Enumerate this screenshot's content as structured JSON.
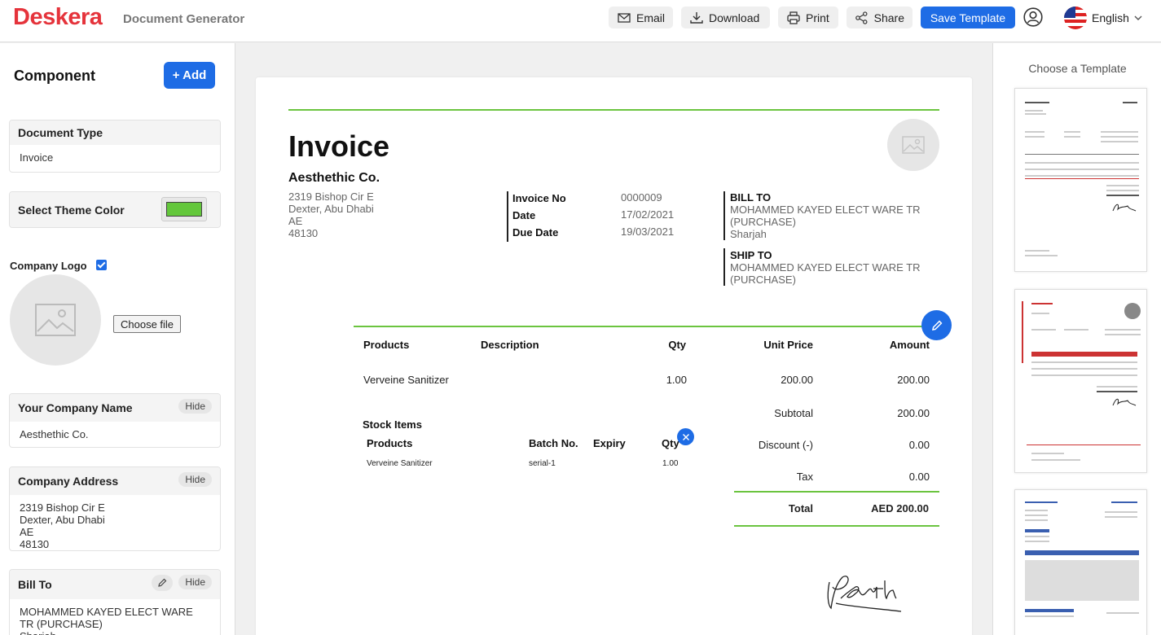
{
  "header": {
    "brand": "Deskera",
    "app_title": "Document Generator",
    "email_label": "Email",
    "download_label": "Download",
    "print_label": "Print",
    "share_label": "Share",
    "save_label": "Save Template",
    "language": "English"
  },
  "sidebar": {
    "title": "Component",
    "add_label": "+ Add",
    "document_type": {
      "label": "Document Type",
      "value": "Invoice"
    },
    "theme": {
      "label": "Select Theme Color",
      "color": "#63c73b"
    },
    "company_logo": {
      "label": "Company Logo",
      "checked": true,
      "choose_label": "Choose file"
    },
    "company_name": {
      "label": "Your Company Name",
      "value": "Aesthethic Co.",
      "hide_label": "Hide"
    },
    "company_address": {
      "label": "Company Address",
      "value": "2319 Bishop Cir E\nDexter, Abu Dhabi\nAE\n48130",
      "hide_label": "Hide"
    },
    "bill_to": {
      "label": "Bill To",
      "value": "MOHAMMED KAYED ELECT WARE\nTR (PURCHASE)\nSharjah",
      "hide_label": "Hide"
    }
  },
  "doc": {
    "title": "Invoice",
    "company_name": "Aesthethic Co.",
    "company_address": "2319 Bishop Cir E\nDexter, Abu Dhabi\nAE\n48130",
    "meta": {
      "invoice_no_label": "Invoice No",
      "invoice_no": "0000009",
      "date_label": "Date",
      "date": "17/02/2021",
      "due_label": "Due Date",
      "due": "19/03/2021"
    },
    "bill_to_label": "BILL TO",
    "bill_to": "MOHAMMED KAYED ELECT WARE TR\n(PURCHASE)\nSharjah",
    "ship_to_label": "SHIP TO",
    "ship_to": "MOHAMMED KAYED ELECT WARE TR\n(PURCHASE)",
    "table": {
      "headers": {
        "products": "Products",
        "description": "Description",
        "qty": "Qty",
        "unit_price": "Unit Price",
        "amount": "Amount"
      },
      "rows": [
        {
          "product": "Verveine Sanitizer",
          "description": "",
          "qty": "1.00",
          "unit_price": "200.00",
          "amount": "200.00"
        }
      ]
    },
    "stock": {
      "title": "Stock Items",
      "headers": {
        "products": "Products",
        "batch": "Batch No.",
        "expiry": "Expiry",
        "qty": "Qty"
      },
      "rows": [
        {
          "product": "Verveine Sanitizer",
          "batch": "serial-1",
          "expiry": "",
          "qty": "1.00"
        }
      ]
    },
    "totals": {
      "subtotal_label": "Subtotal",
      "subtotal": "200.00",
      "discount_label": "Discount (-)",
      "discount": "0.00",
      "tax_label": "Tax",
      "tax": "0.00",
      "total_label": "Total",
      "total": "AED 200.00"
    }
  },
  "templates": {
    "title": "Choose a Template"
  }
}
